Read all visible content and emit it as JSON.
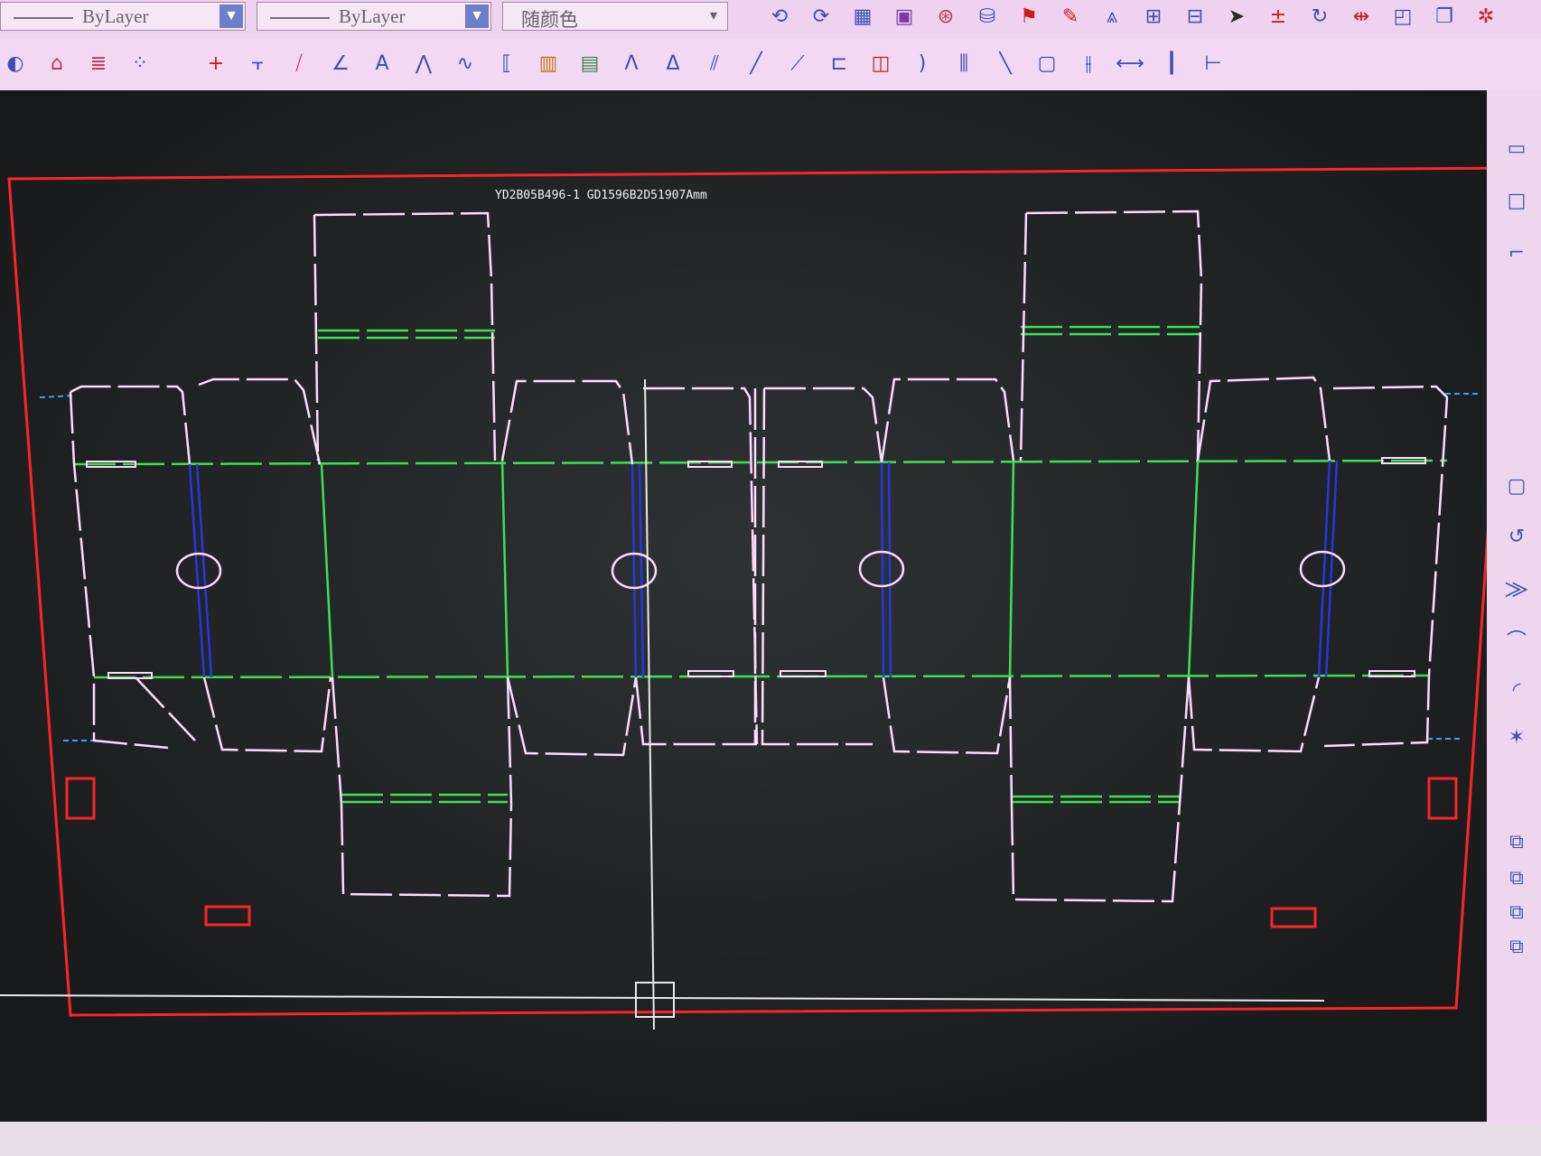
{
  "toolbar": {
    "linetype_combo": {
      "value": "ByLayer"
    },
    "lineweight_combo": {
      "value": "ByLayer"
    },
    "color_combo": {
      "value": "随颜色"
    },
    "top_icons": [
      {
        "name": "undo-arc-icon",
        "glyph": "⟲",
        "color": "#3b4db5"
      },
      {
        "name": "redo-arc-icon",
        "glyph": "⟳",
        "color": "#3b4db5"
      },
      {
        "name": "block-icon",
        "glyph": "▦",
        "color": "#3b4db5"
      },
      {
        "name": "text-style-icon",
        "glyph": "▣",
        "color": "#7a3aa8"
      },
      {
        "name": "zoom-icon",
        "glyph": "⊛",
        "color": "#c0335a"
      },
      {
        "name": "bucket-icon",
        "glyph": "⛁",
        "color": "#3b4db5"
      },
      {
        "name": "flag-icon",
        "glyph": "⚑",
        "color": "#d11a1a"
      },
      {
        "name": "pin-icon",
        "glyph": "✎",
        "color": "#d11a1a"
      },
      {
        "name": "mirror-icon",
        "glyph": "⩓",
        "color": "#3b4db5"
      },
      {
        "name": "array-icon",
        "glyph": "⊞",
        "color": "#3b4db5"
      },
      {
        "name": "grid-icon",
        "glyph": "⊟",
        "color": "#3b4db5"
      },
      {
        "name": "cursor-icon",
        "glyph": "➤",
        "color": "#2b2b2b"
      },
      {
        "name": "zero-icon",
        "glyph": "±",
        "color": "#d11a1a"
      },
      {
        "name": "rotate-icon",
        "glyph": "↻",
        "color": "#3b4db5"
      },
      {
        "name": "stretch-icon",
        "glyph": "⇹",
        "color": "#d11a1a"
      },
      {
        "name": "layer-icon",
        "glyph": "◰",
        "color": "#3b4db5"
      },
      {
        "name": "copy-icon",
        "glyph": "❐",
        "color": "#3b4db5"
      },
      {
        "name": "settings-icon",
        "glyph": "✲",
        "color": "#d11a1a"
      }
    ],
    "left_icons": [
      {
        "name": "circle-tool-icon",
        "glyph": "◐",
        "color": "#3b4db5"
      },
      {
        "name": "building-icon",
        "glyph": "⌂",
        "color": "#c0335a"
      },
      {
        "name": "stack-icon",
        "glyph": "≣",
        "color": "#c0335a"
      },
      {
        "name": "network-icon",
        "glyph": "⁘",
        "color": "#3b4db5"
      }
    ],
    "draw_icons": [
      {
        "name": "cross-icon",
        "glyph": "+",
        "color": "#d11a1a"
      },
      {
        "name": "dimension-icon",
        "glyph": "⫟",
        "color": "#3b4db5"
      },
      {
        "name": "diagonal-icon",
        "glyph": "⧸",
        "color": "#c0335a"
      },
      {
        "name": "angle-icon",
        "glyph": "∠",
        "color": "#3b4db5"
      },
      {
        "name": "text-aa-icon",
        "glyph": "A",
        "color": "#3b4db5"
      },
      {
        "name": "polyline-icon",
        "glyph": "⋀",
        "color": "#3b4db5"
      },
      {
        "name": "wave-icon",
        "glyph": "∿",
        "color": "#3b4db5"
      },
      {
        "name": "bracket-icon",
        "glyph": "⟦",
        "color": "#3b4db5"
      },
      {
        "name": "pattern-icon",
        "glyph": "▥",
        "color": "#c07a1a"
      },
      {
        "name": "ruler-icon",
        "glyph": "▤",
        "color": "#3b8a4a"
      },
      {
        "name": "peak-icon",
        "glyph": "Λ",
        "color": "#3b4db5"
      },
      {
        "name": "peak2-icon",
        "glyph": "Δ",
        "color": "#3b4db5"
      },
      {
        "name": "hatch-icon",
        "glyph": "⫽",
        "color": "#3b4db5"
      },
      {
        "name": "line-icon",
        "glyph": "╱",
        "color": "#3b4db5"
      },
      {
        "name": "slash-icon",
        "glyph": "⟋",
        "color": "#3b4db5"
      },
      {
        "name": "length-icon",
        "glyph": "⊏",
        "color": "#3b4db5"
      },
      {
        "name": "rect-point-icon",
        "glyph": "◫",
        "color": "#d11a1a"
      },
      {
        "name": "arc-icon",
        "glyph": ")",
        "color": "#3b4db5"
      },
      {
        "name": "column-icon",
        "glyph": "⫼",
        "color": "#3b4db5"
      },
      {
        "name": "backslash-icon",
        "glyph": "╲",
        "color": "#3b4db5"
      },
      {
        "name": "box-icon",
        "glyph": "▢",
        "color": "#3b4db5"
      },
      {
        "name": "split-icon",
        "glyph": "⫲",
        "color": "#3b4db5"
      },
      {
        "name": "hline-icon",
        "glyph": "⟷",
        "color": "#3b4db5"
      },
      {
        "name": "vbar-icon",
        "glyph": "┃",
        "color": "#3b4db5"
      },
      {
        "name": "measure-icon",
        "glyph": "⊢",
        "color": "#3b4db5"
      }
    ],
    "side_icons": [
      {
        "name": "side-rect-icon",
        "glyph": "▭"
      },
      {
        "name": "side-square-icon",
        "glyph": "□"
      },
      {
        "name": "side-corner-icon",
        "glyph": "⌐"
      },
      {
        "name": "side-square2-icon",
        "glyph": "▢"
      },
      {
        "name": "side-rotate-icon",
        "glyph": "↺"
      },
      {
        "name": "side-merge-icon",
        "glyph": "⨠"
      },
      {
        "name": "side-curve-icon",
        "glyph": "⌒"
      },
      {
        "name": "side-arc-icon",
        "glyph": "◜"
      },
      {
        "name": "side-brush-icon",
        "glyph": "✶"
      },
      {
        "name": "side-layers-icon",
        "glyph": "⧉"
      },
      {
        "name": "side-layers2-icon",
        "glyph": "⧉"
      },
      {
        "name": "side-layers3-icon",
        "glyph": "⧉"
      },
      {
        "name": "side-layers4-icon",
        "glyph": "⧉"
      }
    ]
  },
  "drawing": {
    "title": "YD2B05B496-1 GD1596B2D51907Amm",
    "colors": {
      "cut_line": "#ffdaff",
      "crease_line": "#3de14f",
      "perforation_line": "#2438e0",
      "guide_line": "#3aa0ff",
      "border": "#ff2424",
      "background": "#1c1e1f"
    }
  }
}
